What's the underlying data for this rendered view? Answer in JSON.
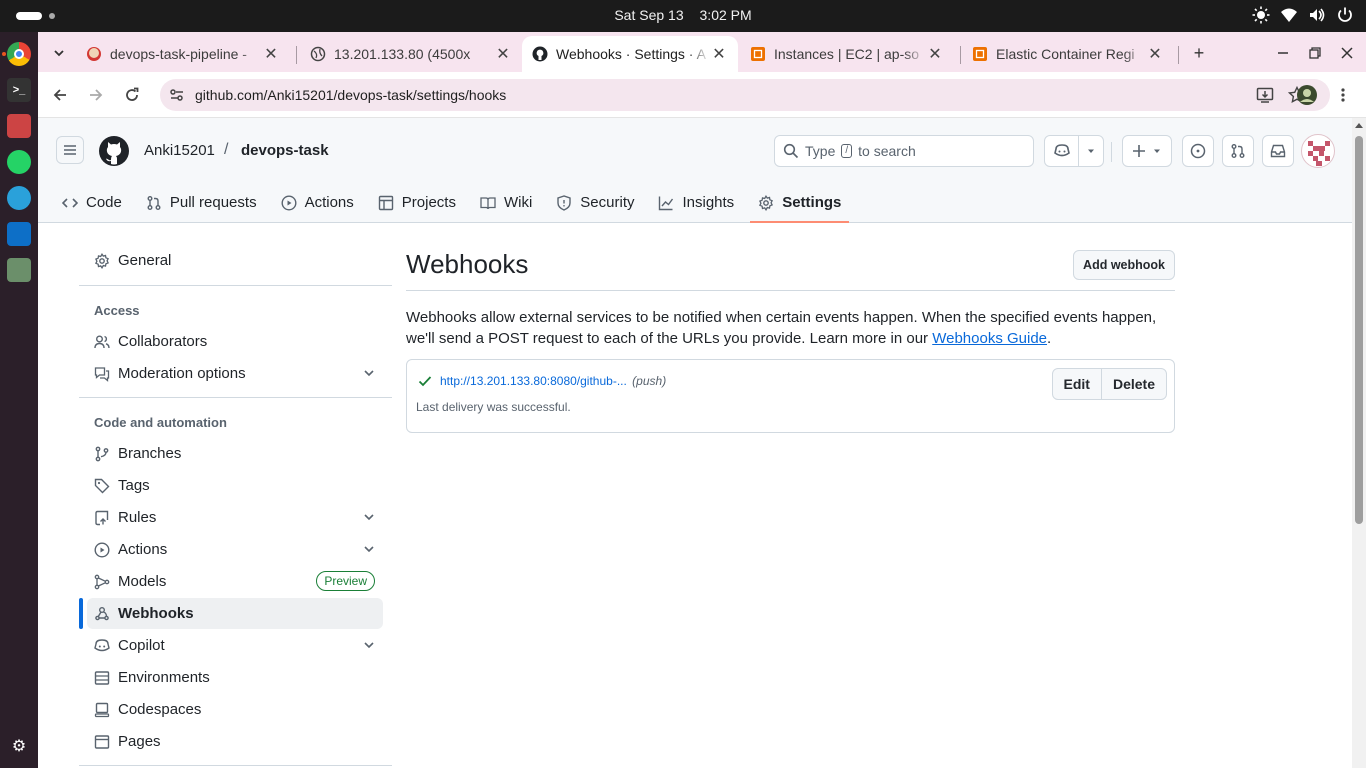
{
  "os": {
    "date": "Sat Sep 13",
    "time": "3:02 PM"
  },
  "browser": {
    "tabs": [
      {
        "title": "devops-task-pipeline -",
        "active": false,
        "icon": "jenkins-icon"
      },
      {
        "title": "13.201.133.80 (4500x",
        "active": false,
        "icon": "globe-icon"
      },
      {
        "title": "Webhooks · Settings · A",
        "active": true,
        "icon": "github-icon"
      },
      {
        "title": "Instances | EC2 | ap-so",
        "active": false,
        "icon": "aws-icon"
      },
      {
        "title": "Elastic Container Regi",
        "active": false,
        "icon": "aws-icon"
      }
    ],
    "url": "github.com/Anki15201/devops-task/settings/hooks"
  },
  "github": {
    "owner": "Anki15201",
    "repo": "devops-task",
    "search_placeholder_pre": "Type",
    "search_key": "/",
    "search_placeholder_post": "to search",
    "repo_nav": [
      {
        "label": "Code",
        "icon": "code-icon"
      },
      {
        "label": "Pull requests",
        "icon": "pull-request-icon"
      },
      {
        "label": "Actions",
        "icon": "play-icon"
      },
      {
        "label": "Projects",
        "icon": "table-icon"
      },
      {
        "label": "Wiki",
        "icon": "book-icon"
      },
      {
        "label": "Security",
        "icon": "shield-icon"
      },
      {
        "label": "Insights",
        "icon": "graph-icon"
      },
      {
        "label": "Settings",
        "icon": "gear-icon",
        "selected": true
      }
    ],
    "sidebar": {
      "general": "General",
      "access_heading": "Access",
      "collaborators": "Collaborators",
      "moderation": "Moderation options",
      "code_heading": "Code and automation",
      "branches": "Branches",
      "tags": "Tags",
      "rules": "Rules",
      "actions": "Actions",
      "models": "Models",
      "models_badge": "Preview",
      "webhooks": "Webhooks",
      "copilot": "Copilot",
      "environments": "Environments",
      "codespaces": "Codespaces",
      "pages": "Pages"
    },
    "main": {
      "title": "Webhooks",
      "add_button": "Add webhook",
      "description": "Webhooks allow external services to be notified when certain events happen. When the specified events happen, we'll send a POST request to each of the URLs you provide. Learn more in our",
      "guide_link": "Webhooks Guide",
      "period": ".",
      "hook_url": "http://13.201.133.80:8080/github-...",
      "hook_event": "(push)",
      "hook_status": "Last delivery was successful.",
      "edit": "Edit",
      "delete": "Delete"
    }
  },
  "colors": {
    "link": "#0969da",
    "success": "#1a7f37",
    "tab_underline": "#fd8c73",
    "tabstrip": "#f7e4ef"
  }
}
